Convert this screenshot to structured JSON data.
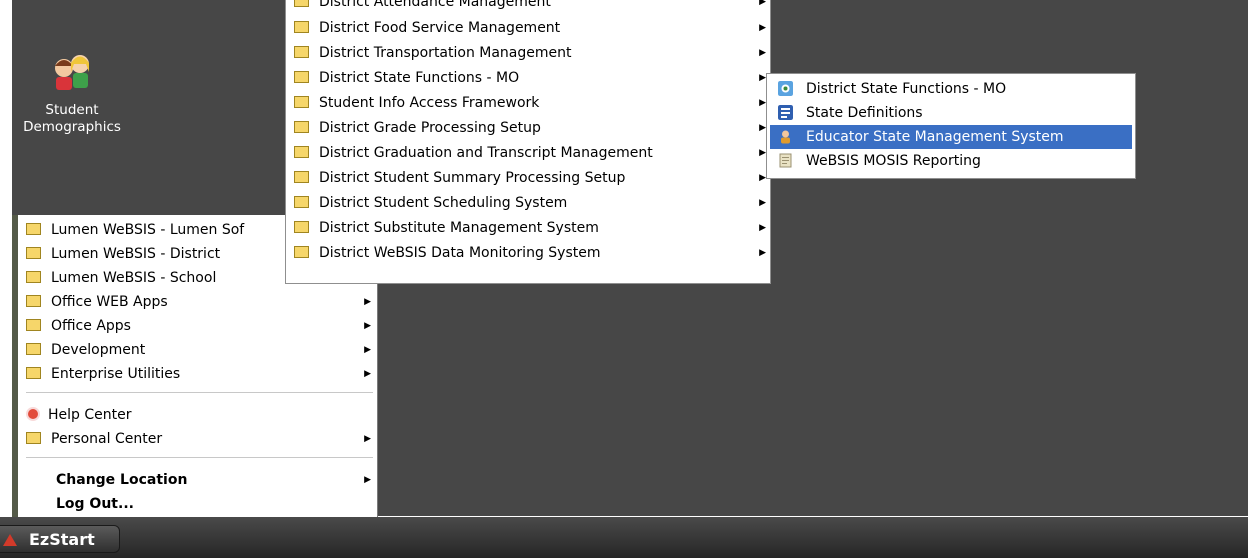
{
  "desktop": {
    "icon": {
      "name": "kids-icon",
      "label_line1": "Student",
      "label_line2": "Demographics"
    },
    "background": "#474747"
  },
  "start_menu": {
    "items": [
      {
        "label": "Lumen WeBSIS - Lumen Sof",
        "icon": "folder-icon",
        "arrow": false
      },
      {
        "label": "Lumen WeBSIS - District",
        "icon": "folder-icon",
        "arrow": false
      },
      {
        "label": "Lumen WeBSIS - School",
        "icon": "folder-icon",
        "arrow": false
      },
      {
        "label": "Office WEB Apps",
        "icon": "folder-icon",
        "arrow": true
      },
      {
        "label": "Office Apps",
        "icon": "folder-icon",
        "arrow": true
      },
      {
        "label": "Development",
        "icon": "folder-icon",
        "arrow": true
      },
      {
        "label": "Enterprise Utilities",
        "icon": "folder-icon",
        "arrow": true
      }
    ],
    "help_center": "Help Center",
    "personal_center": "Personal Center",
    "change_location": "Change Location",
    "log_out": "Log Out..."
  },
  "district_menu": {
    "items": [
      "District Attendance Management",
      "District Food Service Management",
      "District Transportation Management",
      "District State Functions - MO",
      "Student Info Access Framework",
      "District Grade Processing Setup",
      "District Graduation and Transcript Management",
      "District Student Summary Processing Setup",
      "District Student Scheduling System",
      "District Substitute Management System",
      "District WeBSIS Data Monitoring System"
    ]
  },
  "state_menu": {
    "items": [
      {
        "label": "District State Functions - MO",
        "icon": "globe-icon",
        "selected": false
      },
      {
        "label": "State Definitions",
        "icon": "list-icon",
        "selected": false
      },
      {
        "label": "Educator State Management System",
        "icon": "educator-icon",
        "selected": true
      },
      {
        "label": "WeBSIS MOSIS Reporting",
        "icon": "report-icon",
        "selected": false
      }
    ],
    "selected_color": "#3a6fc4"
  },
  "taskbar": {
    "start_label": "EzStart"
  }
}
